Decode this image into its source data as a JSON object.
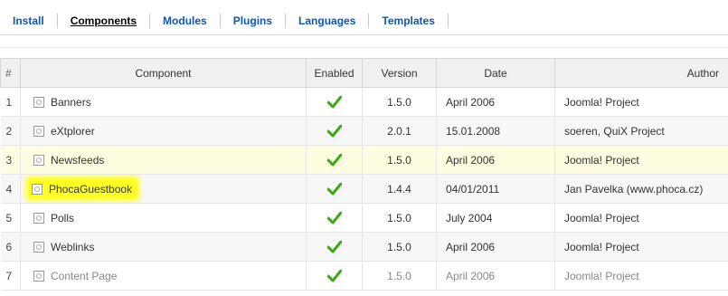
{
  "tabs": [
    {
      "label": "Install",
      "active": false
    },
    {
      "label": "Components",
      "active": true
    },
    {
      "label": "Modules",
      "active": false
    },
    {
      "label": "Plugins",
      "active": false
    },
    {
      "label": "Languages",
      "active": false
    },
    {
      "label": "Templates",
      "active": false
    }
  ],
  "table": {
    "headers": {
      "num": "#",
      "component": "Component",
      "enabled": "Enabled",
      "version": "Version",
      "date": "Date",
      "author": "Author"
    },
    "rows": [
      {
        "num": "1",
        "component": "Banners",
        "enabled": "check-icon",
        "version": "1.5.0",
        "date": "April 2006",
        "author": "Joomla! Project"
      },
      {
        "num": "2",
        "component": "eXtplorer",
        "enabled": "check-icon",
        "version": "2.0.1",
        "date": "15.01.2008",
        "author": "soeren, QuiX Project"
      },
      {
        "num": "3",
        "component": "Newsfeeds",
        "enabled": "check-icon",
        "version": "1.5.0",
        "date": "April 2006",
        "author": "Joomla! Project"
      },
      {
        "num": "4",
        "component": "PhocaGuestbook",
        "enabled": "check-icon",
        "version": "1.4.4",
        "date": "04/01/2011",
        "author": "Jan Pavelka (www.phoca.cz)"
      },
      {
        "num": "5",
        "component": "Polls",
        "enabled": "check-icon",
        "version": "1.5.0",
        "date": "July 2004",
        "author": "Joomla! Project"
      },
      {
        "num": "6",
        "component": "Weblinks",
        "enabled": "check-icon",
        "version": "1.5.0",
        "date": "April 2006",
        "author": "Joomla! Project"
      },
      {
        "num": "7",
        "component": "Content Page",
        "enabled": "check-icon",
        "version": "1.5.0",
        "date": "April 2006",
        "author": "Joomla! Project"
      }
    ]
  },
  "colors": {
    "tab_link": "#0b55c4",
    "highlight": "#ffff26",
    "check": "#3aa818",
    "hover_row": "#fffde0"
  }
}
